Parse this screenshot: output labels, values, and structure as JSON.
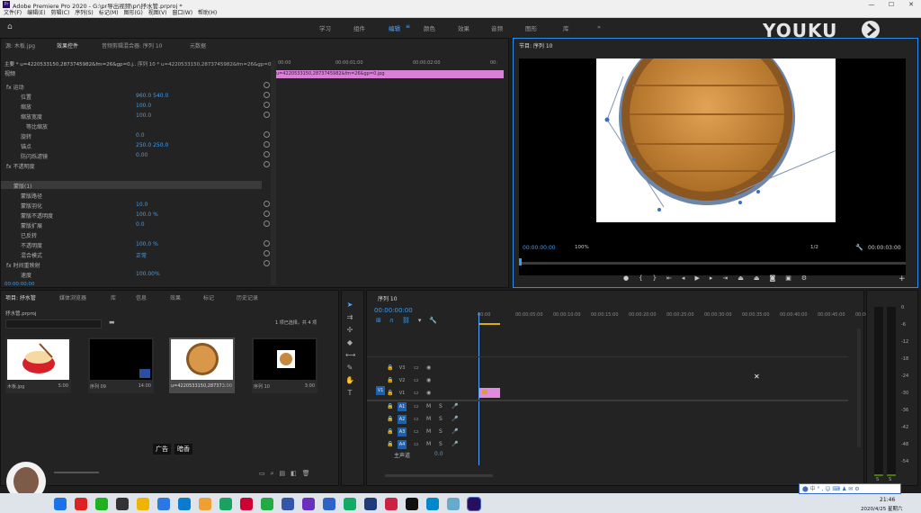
{
  "window": {
    "title": "Adobe Premiere Pro 2020 - G:\\pr导出视频\\pr\\抒水管.prproj *",
    "app_badge": "Pr"
  },
  "menu": [
    "文件(F)",
    "编辑(E)",
    "剪辑(C)",
    "序列(S)",
    "标记(M)",
    "图形(G)",
    "视图(V)",
    "窗口(W)",
    "帮助(H)"
  ],
  "workspaces": [
    "学习",
    "组件",
    "编辑",
    "颜色",
    "效果",
    "音频",
    "图形",
    "库"
  ],
  "active_workspace_index": 2,
  "watermark": "YOUKU",
  "effect_controls": {
    "tabs": [
      "源: 木板.jpg",
      "效果控件",
      "音频剪辑混合器: 序列 10",
      "元数据"
    ],
    "active_tab": 1,
    "clip_header": "主要 * u=4220533150,2873745982&fm=26&gp=0.j...",
    "seq_header": "序列 10 * u=4220533150,2873745982&fm=26&gp=0...",
    "section": "视频",
    "clip_bar": "u=4220533150,2873745982&fm=26&gp=0.jpg",
    "ruler": [
      "00:00",
      "00:00:01:00",
      "00:00:02:00",
      "00:"
    ],
    "rows": [
      {
        "label": "fx  运动",
        "value": ""
      },
      {
        "label": "位置",
        "value": "960.0     540.0"
      },
      {
        "label": "缩放",
        "value": "100.0"
      },
      {
        "label": "缩放宽度",
        "value": "100.0"
      },
      {
        "label": "等比缩放",
        "value": ""
      },
      {
        "label": "旋转",
        "value": "0.0"
      },
      {
        "label": "锚点",
        "value": "250.0     250.0"
      },
      {
        "label": "防闪烁滤镜",
        "value": "0.00"
      },
      {
        "label": "fx  不透明度",
        "value": ""
      },
      {
        "label": "",
        "value": ""
      },
      {
        "label": "蒙版(1)",
        "value": ""
      },
      {
        "label": "蒙版路径",
        "value": ""
      },
      {
        "label": "蒙版羽化",
        "value": "10.0"
      },
      {
        "label": "蒙版不透明度",
        "value": "100.0 %"
      },
      {
        "label": "蒙版扩展",
        "value": "0.0"
      },
      {
        "label": "已反转",
        "value": ""
      },
      {
        "label": "不透明度",
        "value": "100.0 %"
      },
      {
        "label": "混合模式",
        "value": "正常"
      },
      {
        "label": "fx  时间重映射",
        "value": ""
      },
      {
        "label": "速度",
        "value": "100.00%"
      }
    ],
    "timecode": "00:00:00:00"
  },
  "program_monitor": {
    "title": "节目: 序列 10",
    "timecode": "00:00:00:00",
    "zoom": "100%",
    "quality": "1/2",
    "duration": "00:00:03:00"
  },
  "project": {
    "tabs": [
      "项目: 抒水管",
      "媒体浏览器",
      "库",
      "信息",
      "效果",
      "标记",
      "历史记录"
    ],
    "active_tab": 0,
    "file": "抒水管.prproj",
    "selection_info": "1 项已选择，共 4 项",
    "items": [
      {
        "name": "木板.jpg",
        "duration": "5:00"
      },
      {
        "name": "序列 09",
        "duration": "14:00"
      },
      {
        "name": "u=4220533150,28737...",
        "duration": "3:00"
      },
      {
        "name": "序列 10",
        "duration": "3:00"
      }
    ]
  },
  "timeline": {
    "title": "序列 10",
    "timecode": "00:00:00:00",
    "ruler": [
      "00:00",
      "00:00:05:00",
      "00:00:10:00",
      "00:00:15:00",
      "00:00:20:00",
      "00:00:25:00",
      "00:00:30:00",
      "00:00:35:00",
      "00:00:40:00",
      "00:00:45:00",
      "00:00:"
    ],
    "video_tracks": [
      "V3",
      "V2",
      "V1"
    ],
    "audio_tracks": [
      "A1",
      "A2",
      "A3",
      "A4"
    ],
    "master": "主声道",
    "master_value": "0.0",
    "source_patch": "V1"
  },
  "meter_labels": [
    "0",
    "-6",
    "-12",
    "-18",
    "-24",
    "-30",
    "-36",
    "-42",
    "-48",
    "-54"
  ],
  "meter_bottom": [
    "S",
    "S"
  ],
  "subtitle": [
    "广告",
    "暗香"
  ],
  "clock": {
    "time": "21:46",
    "date": "2020/4/25 星期六"
  }
}
